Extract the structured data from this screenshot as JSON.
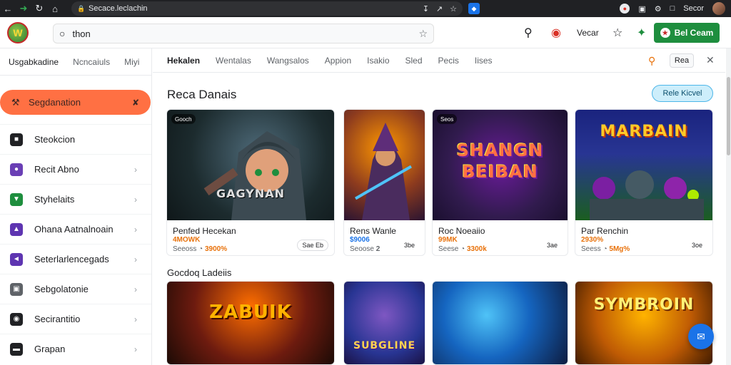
{
  "browser": {
    "url": "Secace.leclachin",
    "right_label": "Secor"
  },
  "header": {
    "search_value": "thon",
    "link_label": "Vecar",
    "cta_label": "Bel Ceam"
  },
  "sidebar": {
    "tabs": [
      "Usgabkadine",
      "Ncncaiuls",
      "Miyi"
    ],
    "active_item": "Segdanation",
    "items": [
      {
        "label": "Steokcion",
        "color": "#202124",
        "chevron": false
      },
      {
        "label": "Recit Abno",
        "color": "#6a3fb5",
        "chevron": true
      },
      {
        "label": "Styhelaits",
        "color": "#1e8e3e",
        "chevron": true
      },
      {
        "label": "Ohana Aatnalnoain",
        "color": "#5e35b1",
        "chevron": true
      },
      {
        "label": "Seterlarlencegads",
        "color": "#5e35b1",
        "chevron": true
      },
      {
        "label": "Sebgolatonie",
        "color": "#5f6368",
        "chevron": true
      },
      {
        "label": "Secirantitio",
        "color": "#202124",
        "chevron": true
      },
      {
        "label": "Grapan",
        "color": "#202124",
        "chevron": true
      }
    ]
  },
  "main": {
    "tabs": [
      "Hekalen",
      "Wentalas",
      "Wangsalos",
      "Appion",
      "Isakio",
      "Sled",
      "Pecis",
      "Iises"
    ],
    "tab_button": "Rea",
    "section_title": "Reca Danais",
    "section_button": "Rele Kicvel",
    "section2_title": "Gocdoq Ladeiis",
    "cards": [
      {
        "tag": "Gooch",
        "art_text": "GAGYNAN",
        "title": "Penfed Hecekan",
        "price": "4MOWK",
        "meta_left": "Seeoss",
        "meta_val": "3900%",
        "badge": "Sae Eb"
      },
      {
        "tag": "",
        "art_text": "",
        "title": "Rens Wanle",
        "price": "$9006",
        "meta_left": "Seoose",
        "meta_val": "2",
        "badge": "3be"
      },
      {
        "tag": "Seos",
        "art_text": "SHANGN BEIBAN",
        "title": "Roc Noeaiio",
        "price": "99MK",
        "meta_left": "Seese",
        "meta_val": "3300k",
        "badge": "3ae"
      },
      {
        "tag": "",
        "art_text": "MARBAIN",
        "title": "Par Renchin",
        "price": "2930%",
        "meta_left": "Seess",
        "meta_val": "5Mg%",
        "badge": "3oe"
      },
      {
        "art_text": "ZABUIK"
      },
      {
        "art_text": "SUBGLINE"
      },
      {
        "art_text": ""
      },
      {
        "art_text": "SYMBROIN"
      }
    ]
  },
  "colors": {
    "accent": "#ff7043",
    "cta": "#1e8e3e",
    "price": "#e8710a",
    "fab": "#1a73e8"
  }
}
